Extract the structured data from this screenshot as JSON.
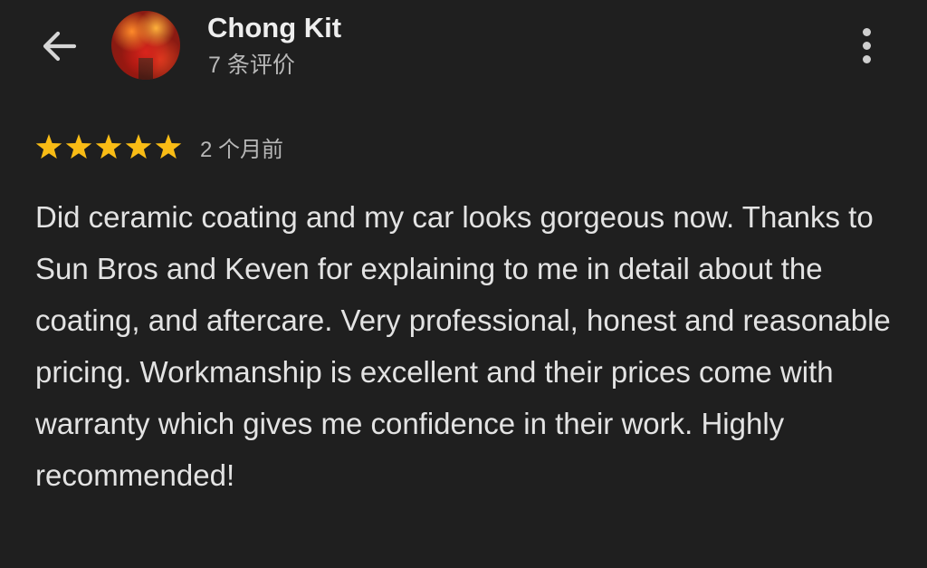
{
  "header": {
    "back_icon": "arrow-left-icon",
    "avatar_icon": "avatar-autumn-tree",
    "user_name": "Chong Kit",
    "review_count": "7 条评价",
    "more_icon": "more-vertical-icon"
  },
  "review": {
    "rating": 5,
    "rating_max": 5,
    "star_color": "#f9bc15",
    "date": "2 个月前",
    "text": "Did ceramic coating and my car looks gorgeous now. Thanks to Sun Bros and Keven for explaining to me in detail about the coating, and aftercare. Very professional, honest and reasonable pricing. Workmanship is excellent and their prices come with warranty which gives me confidence in their work. Highly recommended!"
  },
  "colors": {
    "background": "#1f1f1f",
    "text_primary": "#e3e3e3",
    "text_secondary": "#b8b8b8"
  }
}
